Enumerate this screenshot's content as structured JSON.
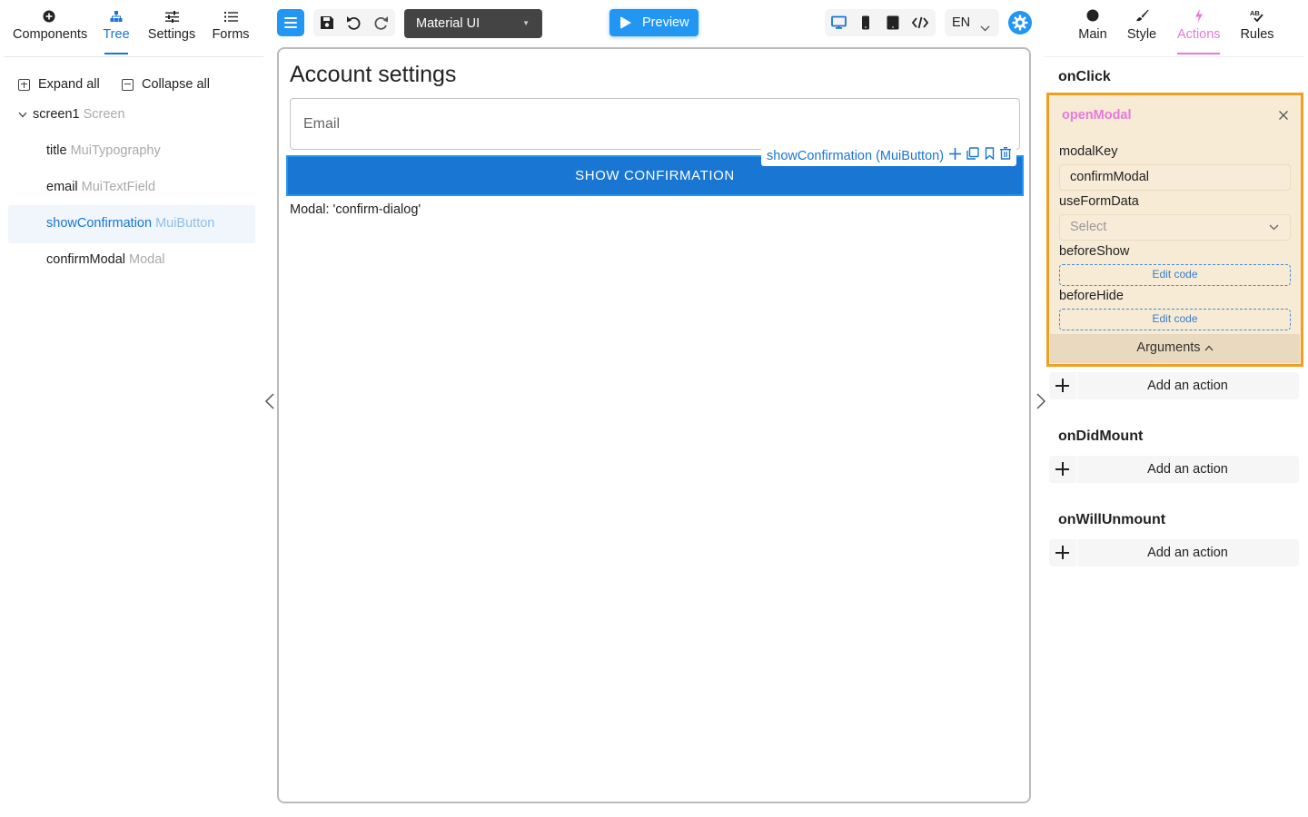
{
  "left_panel": {
    "tabs": [
      {
        "label": "Components",
        "icon": "plus-circle-icon"
      },
      {
        "label": "Tree",
        "icon": "tree-icon"
      },
      {
        "label": "Settings",
        "icon": "sliders-icon"
      },
      {
        "label": "Forms",
        "icon": "list-icon"
      }
    ],
    "active_tab": "Tree",
    "expand_all": "Expand all",
    "collapse_all": "Collapse all",
    "tree": {
      "root": {
        "name": "screen1",
        "type": "Screen"
      },
      "children": [
        {
          "name": "title",
          "type": "MuiTypography"
        },
        {
          "name": "email",
          "type": "MuiTextField"
        },
        {
          "name": "showConfirmation",
          "type": "MuiButton",
          "selected": true
        },
        {
          "name": "confirmModal",
          "type": "Modal"
        }
      ]
    }
  },
  "toolbar": {
    "theme_select": "Material UI",
    "preview_label": "Preview",
    "language": "EN",
    "icons": [
      "menu-icon",
      "save-icon",
      "undo-icon",
      "redo-icon",
      "desktop-icon",
      "tablet-icon",
      "mobile-icon",
      "code-icon",
      "settings-icon"
    ]
  },
  "canvas": {
    "title": "Account settings",
    "email_placeholder": "Email",
    "button_label": "SHOW CONFIRMATION",
    "selection_label": "showConfirmation (MuiButton)",
    "modal_text": "Modal: 'confirm-dialog'"
  },
  "right_panel": {
    "tabs": [
      {
        "label": "Main",
        "icon": "circle-icon"
      },
      {
        "label": "Style",
        "icon": "brush-icon"
      },
      {
        "label": "Actions",
        "icon": "bolt-icon"
      },
      {
        "label": "Rules",
        "icon": "spellcheck-icon"
      }
    ],
    "active_tab": "Actions",
    "on_click": {
      "event": "onClick",
      "action": {
        "name": "openModal",
        "modal_key_label": "modalKey",
        "modal_key_value": "confirmModal",
        "use_form_data_label": "useFormData",
        "use_form_data_placeholder": "Select",
        "before_show_label": "beforeShow",
        "before_show_button": "Edit code",
        "before_hide_label": "beforeHide",
        "before_hide_button": "Edit code",
        "arguments_label": "Arguments"
      },
      "add_action": "Add an action"
    },
    "on_did_mount": {
      "event": "onDidMount",
      "add_action": "Add an action"
    },
    "on_will_unmount": {
      "event": "onWillUnmount",
      "add_action": "Add an action"
    }
  },
  "colors": {
    "accent": "#1976d2",
    "primary_button": "#2196f3",
    "actions_tab": "#e879d8",
    "highlight_border": "#f0a020"
  }
}
